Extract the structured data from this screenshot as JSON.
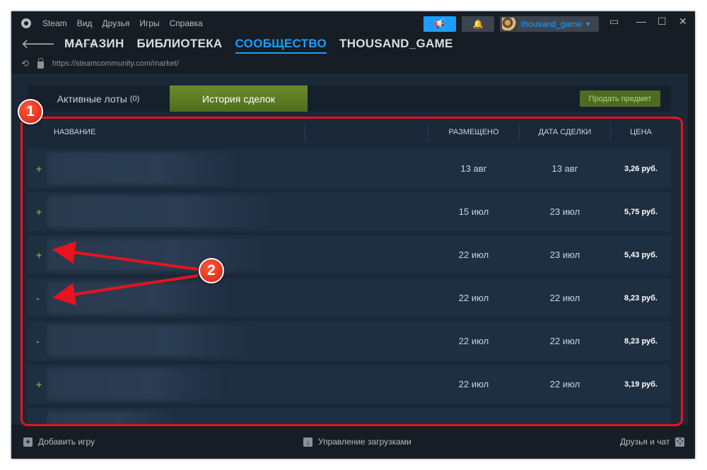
{
  "menu": {
    "app_name": "Steam",
    "items": [
      "Вид",
      "Друзья",
      "Игры",
      "Справка"
    ]
  },
  "header": {
    "username": "thousand_game",
    "announce_icon": "megaphone-icon",
    "notify_icon": "bell-icon"
  },
  "nav": {
    "links": [
      "МАГАЗИН",
      "БИБЛИОТЕКА",
      "СООБЩЕСТВО",
      "THOUSAND_GAME"
    ],
    "active": "СООБЩЕСТВО"
  },
  "url": "https://steamcommunity.com/market/",
  "tabs": {
    "active_lots_label": "Активные лоты",
    "active_lots_count": "(0)",
    "history_label": "История сделок",
    "sell_button": "Продать предмет"
  },
  "table": {
    "headers": {
      "name": "НАЗВАНИЕ",
      "listed": "РАЗМЕЩЕНО",
      "acted": "ДАТА СДЕЛКИ",
      "price": "ЦЕНА"
    },
    "rows": [
      {
        "sign": "+",
        "listed": "13 авг",
        "acted": "13 авг",
        "price": "3,26 руб."
      },
      {
        "sign": "+",
        "listed": "15 июл",
        "acted": "23 июл",
        "price": "5,75 руб."
      },
      {
        "sign": "+",
        "listed": "22 июл",
        "acted": "23 июл",
        "price": "5,43 руб."
      },
      {
        "sign": "-",
        "listed": "22 июл",
        "acted": "22 июл",
        "price": "8,23 руб."
      },
      {
        "sign": "-",
        "listed": "22 июл",
        "acted": "22 июл",
        "price": "8,23 руб."
      },
      {
        "sign": "+",
        "listed": "22 июл",
        "acted": "22 июл",
        "price": "3,19 руб."
      }
    ]
  },
  "annotations": {
    "badge1": "1",
    "badge2": "2",
    "color": "#e8131f"
  },
  "bottom": {
    "add_game": "Добавить игру",
    "downloads": "Управление загрузками",
    "friends": "Друзья и чат"
  }
}
